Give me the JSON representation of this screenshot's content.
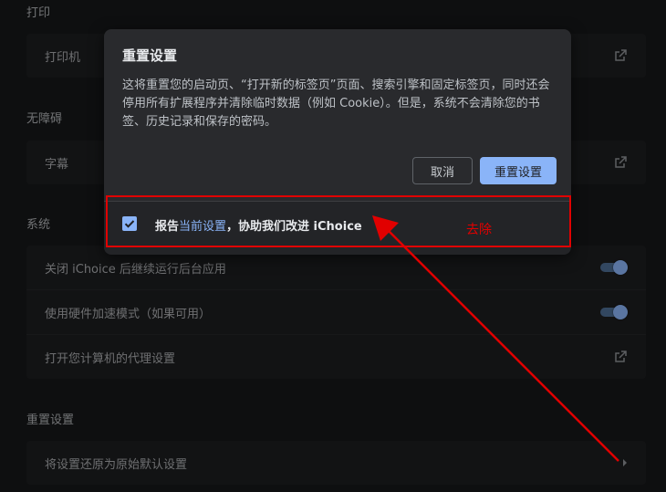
{
  "sections": {
    "print": {
      "title": "打印",
      "rows": [
        {
          "label": "打印机",
          "icon": "external-link-icon"
        }
      ]
    },
    "accessibility": {
      "title": "无障碍",
      "rows": [
        {
          "label": "字幕",
          "icon": "external-link-icon"
        }
      ]
    },
    "system": {
      "title": "系统",
      "rows": [
        {
          "label": "关闭 iChoice 后继续运行后台应用",
          "control": "toggle",
          "checked": true
        },
        {
          "label": "使用硬件加速模式（如果可用）",
          "control": "toggle",
          "checked": true
        },
        {
          "label": "打开您计算机的代理设置",
          "icon": "external-link-icon"
        }
      ]
    },
    "reset": {
      "title": "重置设置",
      "rows": [
        {
          "label": "将设置还原为原始默认设置",
          "icon": "chevron-right-icon"
        }
      ]
    }
  },
  "dialog": {
    "title": "重置设置",
    "body": "这将重置您的启动页、“打开新的标签页”页面、搜索引擎和固定标签页，同时还会停用所有扩展程序并清除临时数据（例如 Cookie）。但是，系统不会清除您的书签、历史记录和保存的密码。",
    "cancel_label": "取消",
    "reset_label": "重置设置",
    "report": {
      "checked": true,
      "prefix": "报告",
      "link": "当前设置",
      "suffix": "，协助我们改进 iChoice"
    }
  },
  "annotation": {
    "text": "去除",
    "color": "#e10000"
  },
  "colors": {
    "accent": "#8ab4f8",
    "background": "#161719",
    "dialog": "#292a2d"
  }
}
